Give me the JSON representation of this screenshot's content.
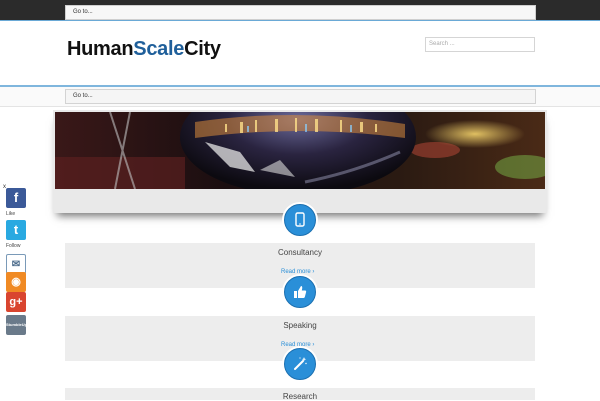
{
  "topbar": {
    "goto_label": "Go to..."
  },
  "header": {
    "logo": {
      "part1": "Human",
      "part2": "Scale",
      "part3": "City"
    },
    "search_placeholder": "Search ..."
  },
  "nav": {
    "goto_label": "Go to..."
  },
  "social": {
    "close": "x",
    "like_label": "Like",
    "follow_label": "Follow",
    "stumble_label": "StumbleUpon",
    "icons": [
      "facebook-icon",
      "twitter-icon",
      "email-icon",
      "rss-icon",
      "google-plus-icon",
      "stumbleupon-icon"
    ]
  },
  "features": [
    {
      "title": "Consultancy",
      "more": "Read more ›",
      "icon": "tablet-icon"
    },
    {
      "title": "Speaking",
      "more": "Read more ›",
      "icon": "thumbs-up-icon"
    },
    {
      "title": "Research",
      "more": "",
      "icon": "magic-wand-icon"
    }
  ],
  "colors": {
    "accent": "#2a8fd8",
    "logo_blue": "#1f5f9a",
    "topbar": "#2b2b2b"
  }
}
